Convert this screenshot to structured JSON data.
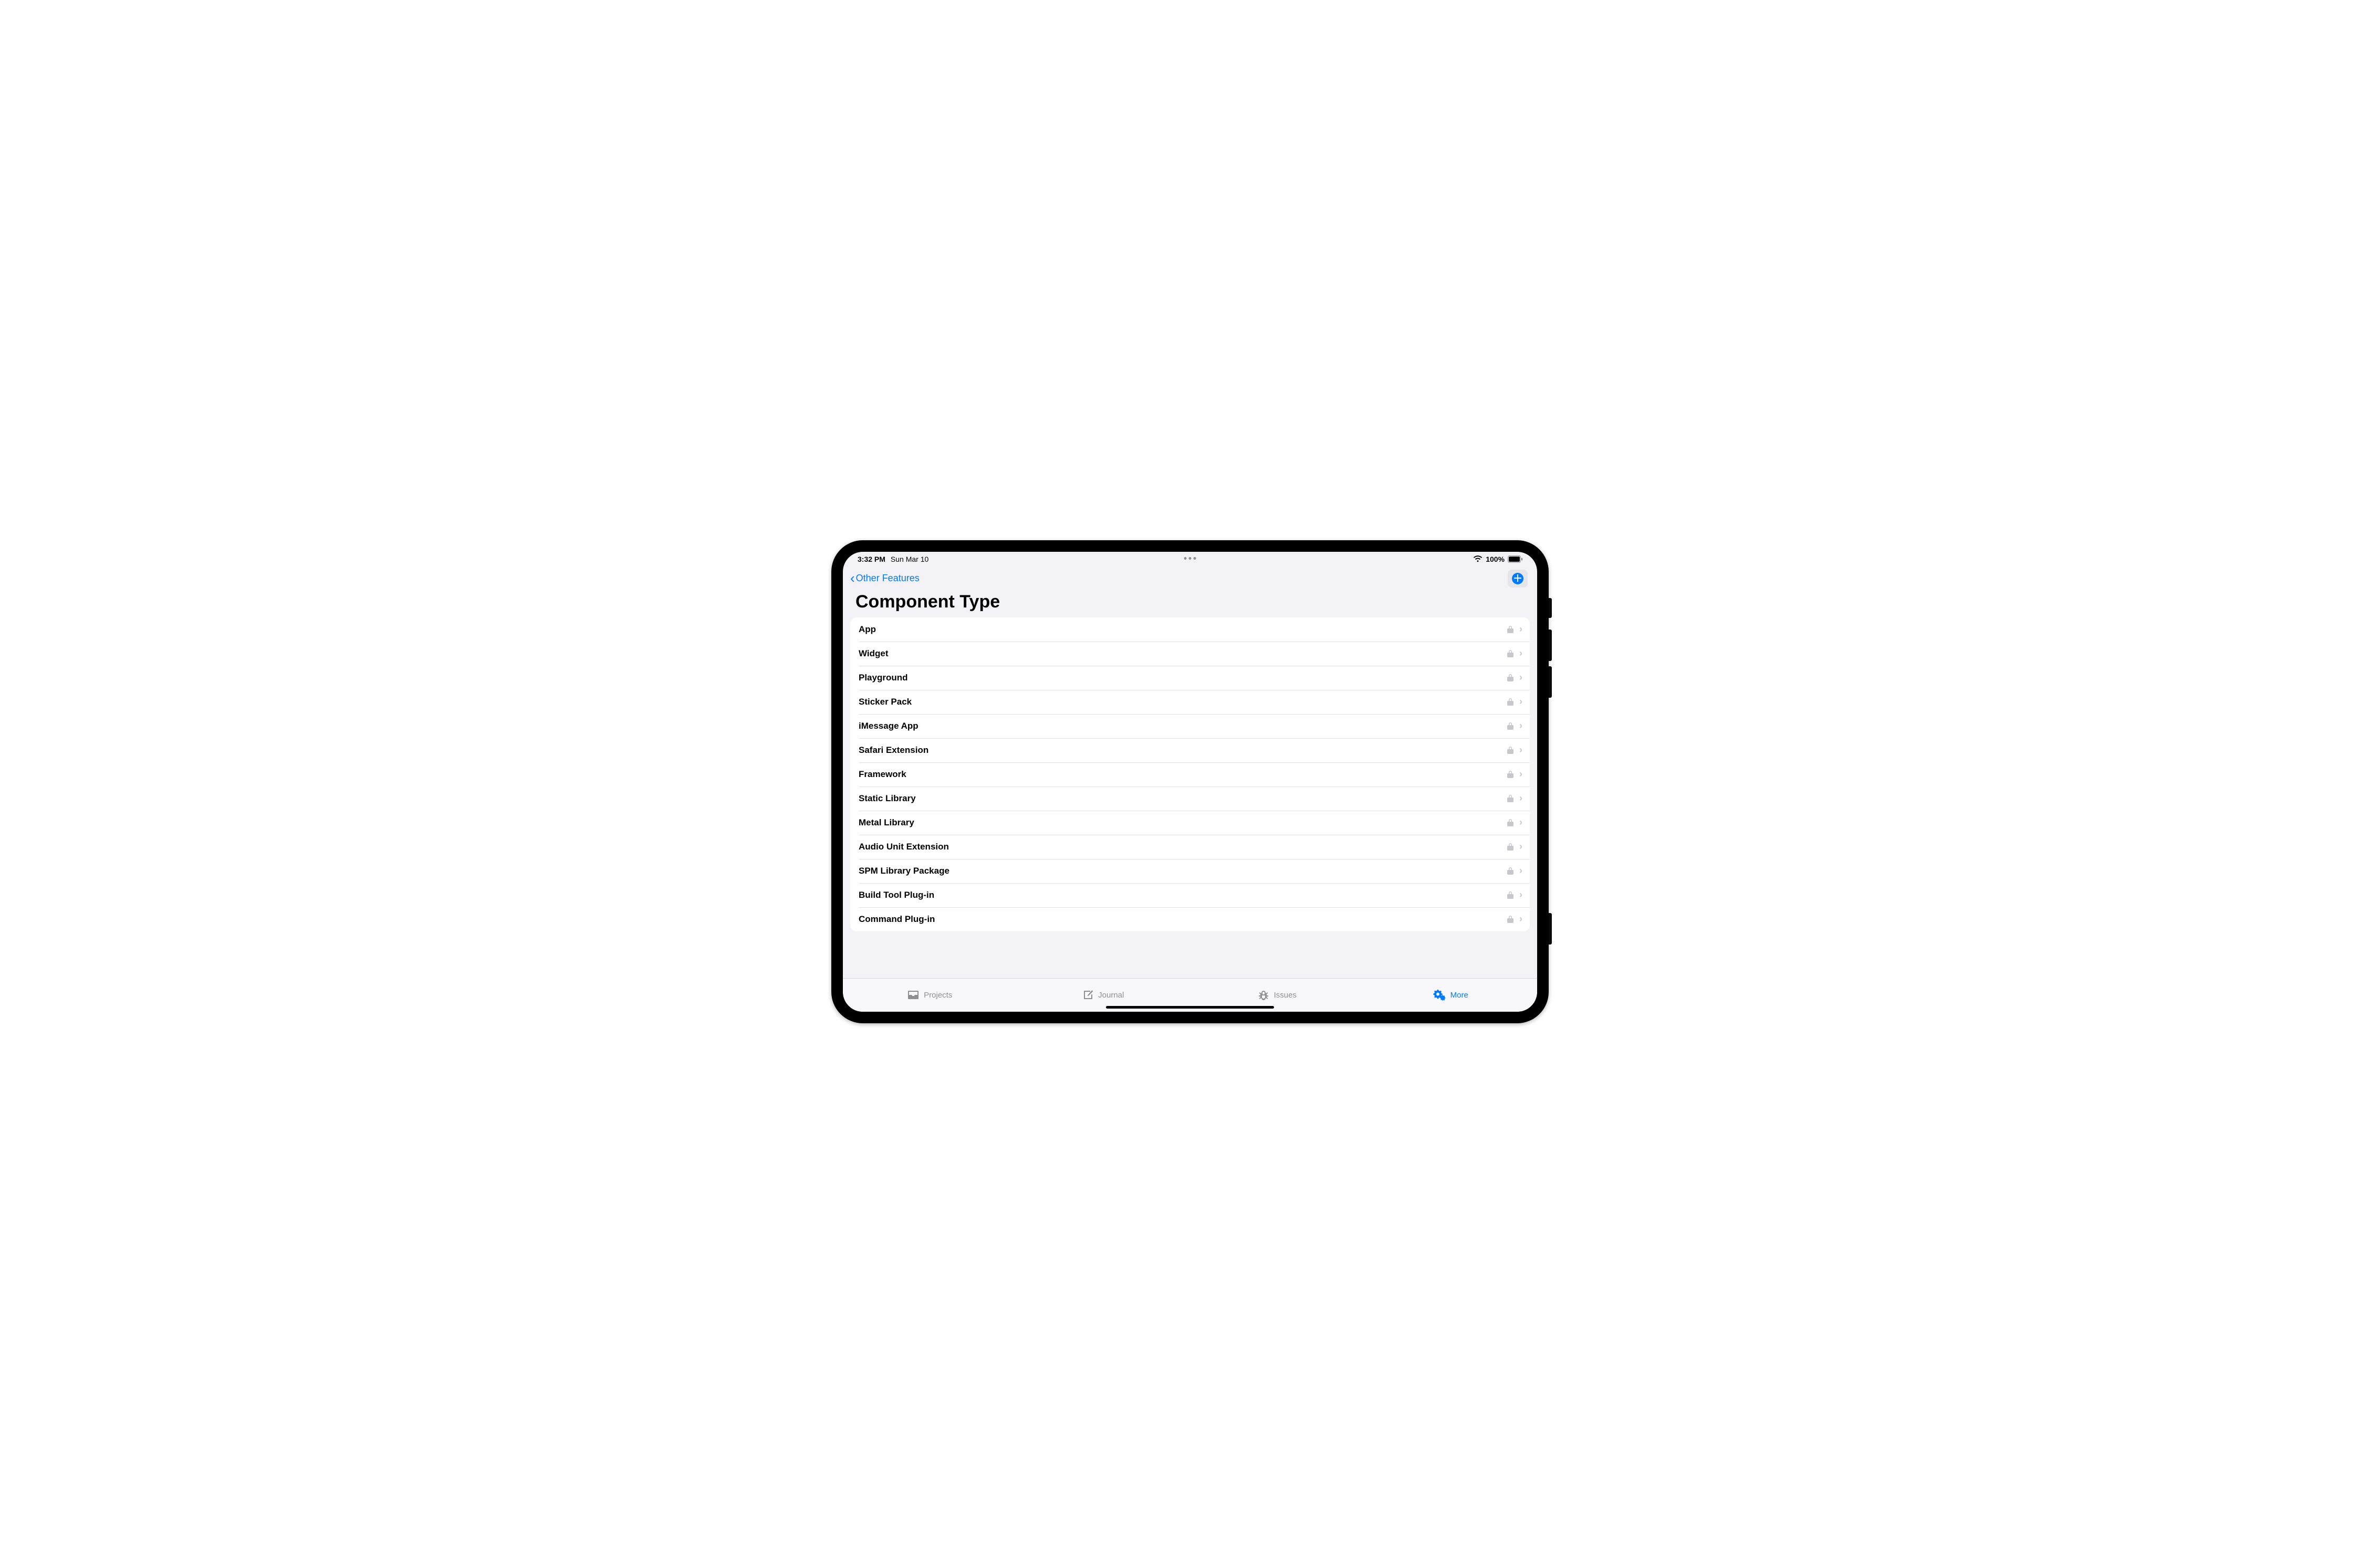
{
  "status": {
    "time": "3:32 PM",
    "date": "Sun Mar 10",
    "battery_pct": "100%"
  },
  "nav": {
    "back_label": "Other Features"
  },
  "title": "Component Type",
  "rows": [
    {
      "label": "App"
    },
    {
      "label": "Widget"
    },
    {
      "label": "Playground"
    },
    {
      "label": "Sticker Pack"
    },
    {
      "label": "iMessage App"
    },
    {
      "label": "Safari Extension"
    },
    {
      "label": "Framework"
    },
    {
      "label": "Static Library"
    },
    {
      "label": "Metal Library"
    },
    {
      "label": "Audio Unit Extension"
    },
    {
      "label": "SPM Library Package"
    },
    {
      "label": "Build Tool Plug-in"
    },
    {
      "label": "Command Plug-in"
    }
  ],
  "tabs": [
    {
      "label": "Projects"
    },
    {
      "label": "Journal"
    },
    {
      "label": "Issues"
    },
    {
      "label": "More"
    }
  ]
}
